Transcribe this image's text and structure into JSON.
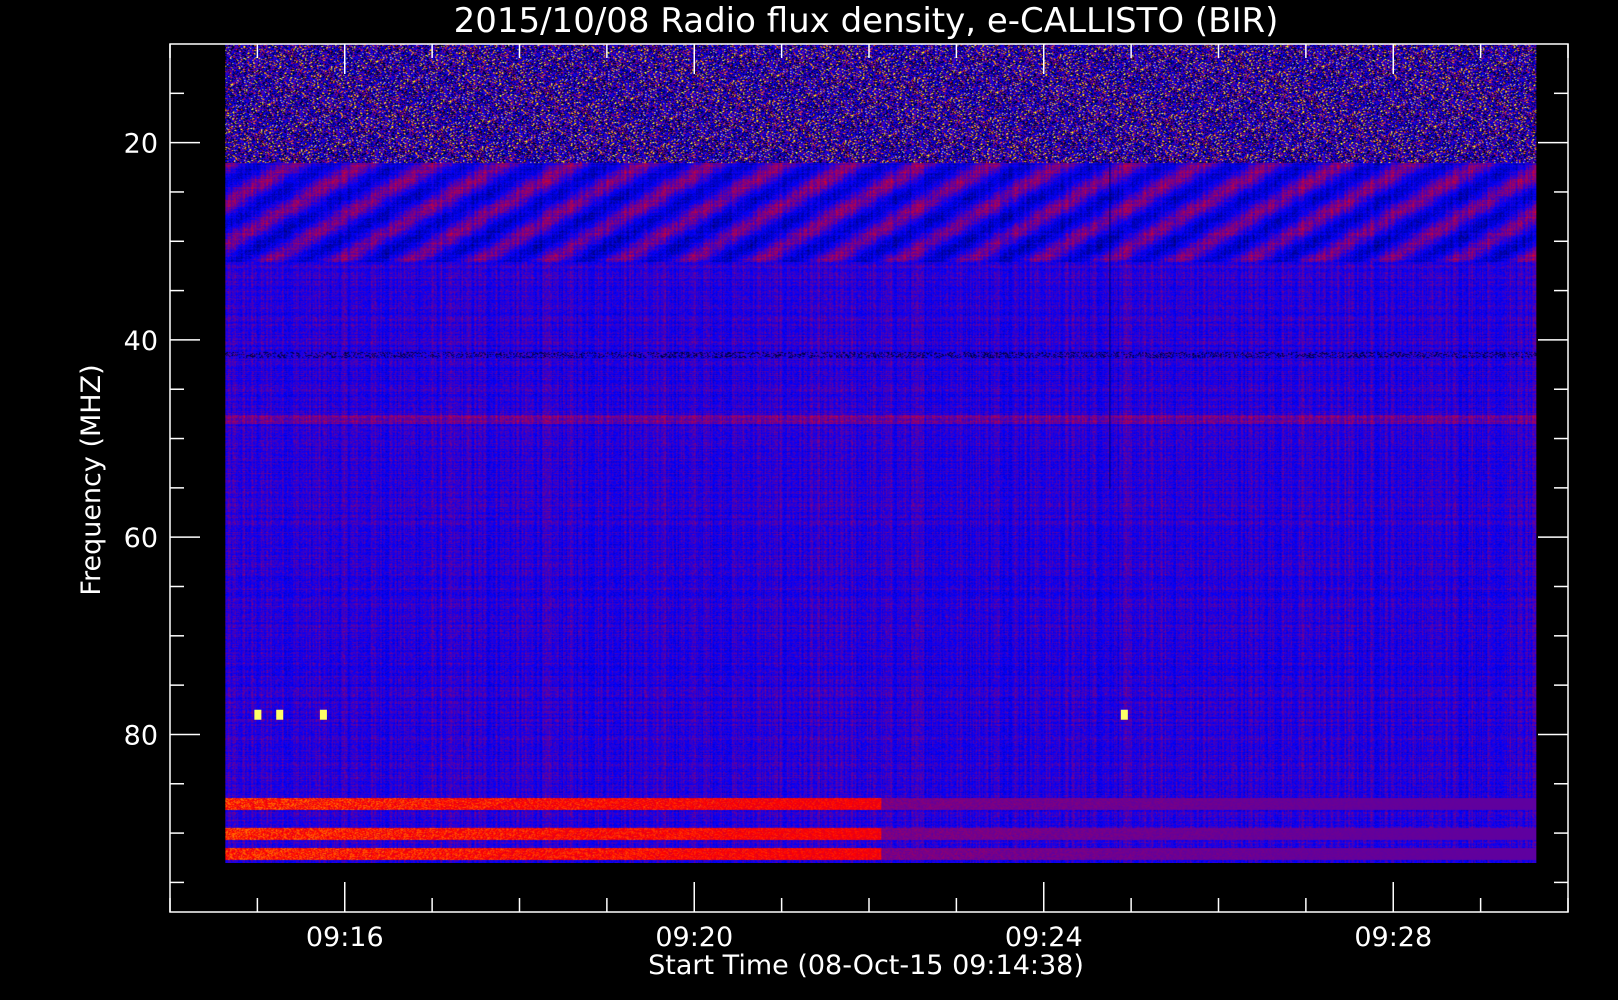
{
  "chart_data": {
    "type": "heatmap",
    "title": "2015/10/08  Radio flux density, e-CALLISTO (BIR)",
    "xlabel": "Start Time (08-Oct-15 09:14:38)",
    "ylabel": "Frequency (MHZ)",
    "x_axis": {
      "range_minutes": [
        "09:14",
        "09:30"
      ],
      "data_extent": [
        "09:14:38",
        "09:29:38"
      ],
      "major_ticks": [
        "09:16",
        "09:20",
        "09:24",
        "09:28"
      ],
      "minor_tick_interval_min": 1
    },
    "y_axis": {
      "range": [
        10,
        98
      ],
      "inverted": true,
      "data_extent": [
        10,
        93
      ],
      "major_ticks": [
        20,
        40,
        60,
        80
      ],
      "minor_tick_interval": 5
    },
    "colormap": {
      "name": "blue-red-yellow",
      "stops": [
        "#000000",
        "#0000ff",
        "#ff0000",
        "#ffff00",
        "#ffffff"
      ]
    },
    "features": [
      {
        "kind": "interference_band",
        "freq_range": [
          10,
          22
        ]
      },
      {
        "kind": "spike",
        "time": "09:15:00",
        "freq": 78
      },
      {
        "kind": "spike",
        "time": "09:15:15",
        "freq": 78
      },
      {
        "kind": "spike",
        "time": "09:15:45",
        "freq": 78
      },
      {
        "kind": "spike",
        "time": "09:24:55",
        "freq": 78
      },
      {
        "kind": "vertical_artifact",
        "time": "09:24:45",
        "freq_range": [
          22,
          55
        ]
      },
      {
        "kind": "strong_band",
        "freq": 90
      },
      {
        "kind": "strong_band",
        "freq": 87
      },
      {
        "kind": "strong_band",
        "freq": 92
      }
    ],
    "grid": false,
    "legend": "none",
    "background": "#000000",
    "axis_color": "#ffffff"
  }
}
